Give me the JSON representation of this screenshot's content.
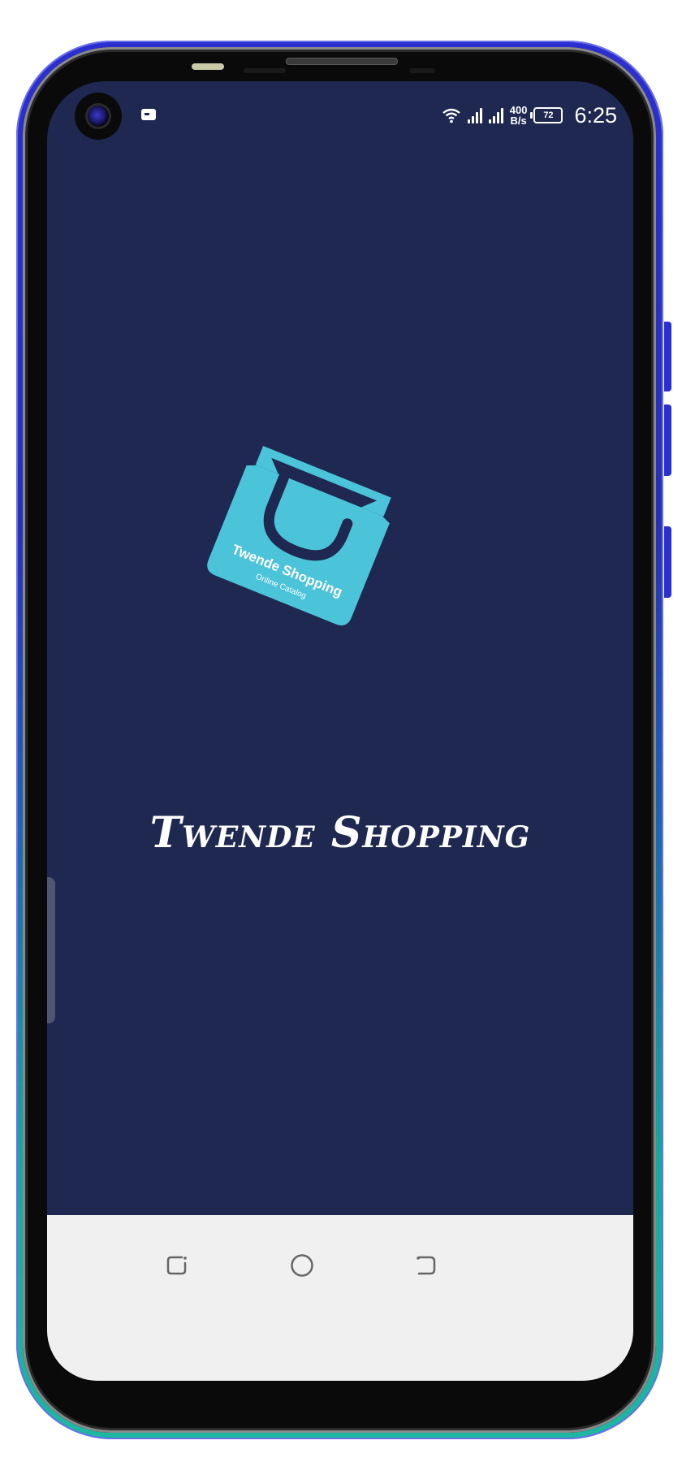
{
  "status_bar": {
    "network_speed_value": "400",
    "network_speed_unit": "B/s",
    "battery_level": "72",
    "time": "6:25"
  },
  "app": {
    "logo_text": "Twende Shopping",
    "logo_subtext": "Online Catalog",
    "title": "Twende Shopping"
  },
  "colors": {
    "screen_background": "#1e2850",
    "logo_bag": "#4bc3d8",
    "title_text": "#ffffff",
    "nav_bar": "#f0f0f0"
  },
  "icons": {
    "nav_recent": "recent-apps-icon",
    "nav_home": "home-circle-icon",
    "nav_back": "back-icon"
  }
}
